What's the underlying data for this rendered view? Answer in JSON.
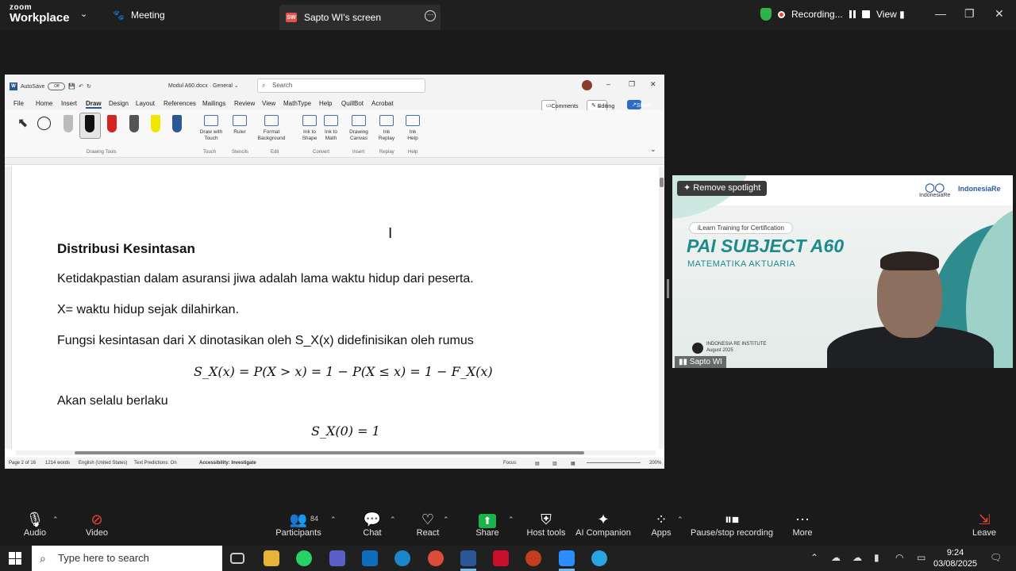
{
  "zoom_top": {
    "logo_line1": "zoom",
    "logo_line2": "Workplace",
    "meeting_label": "Meeting",
    "share_badge": "SW",
    "share_tab_label": "Sapto WI's screen",
    "recording_label": "Recording...",
    "view_label": "View"
  },
  "word": {
    "autosave_label": "AutoSave",
    "autosave_state": "Off",
    "doc_name": "Modul A60.docx",
    "sensitivity": "General",
    "search_placeholder": "Search",
    "menu": [
      "File",
      "Home",
      "Insert",
      "Draw",
      "Design",
      "Layout",
      "References",
      "Mailings",
      "Review",
      "View",
      "MathType",
      "Help",
      "QuillBot",
      "Acrobat"
    ],
    "active_menu": "Draw",
    "comments_label": "Comments",
    "editing_label": "Editing",
    "share_label": "Share",
    "ribbon": {
      "draw_with_touch": "Draw with Touch",
      "ruler": "Ruler",
      "format_background": "Format Background",
      "ink_to_shape": "Ink to Shape",
      "ink_to_math": "Ink to Math",
      "drawing_canvas": "Drawing Canvas",
      "ink_replay": "Ink Replay",
      "ink_help": "Ink Help",
      "groups": [
        "Drawing Tools",
        "Touch",
        "Stencils",
        "Edit",
        "Convert",
        "Insert",
        "Replay",
        "Help"
      ]
    },
    "document": {
      "heading": "Distribusi Kesintasan",
      "p1": "Ketidakpastian dalam asuransi jiwa adalah lama waktu hidup dari peserta.",
      "p2": "X= waktu hidup sejak dilahirkan.",
      "p3": "Fungsi kesintasan dari X dinotasikan oleh S_X(x) didefinisikan oleh rumus",
      "eq1": "S_X(x) = P(X > x) = 1 − P(X ≤ x) = 1 − F_X(x)",
      "p4": "Akan selalu berlaku",
      "eq2": "S_X(0) = 1"
    },
    "status": {
      "page": "Page 2 of 16",
      "words": "1214 words",
      "language": "English (United States)",
      "predictions": "Text Predictions: On",
      "accessibility": "Accessibility: Investigate",
      "focus": "Focus",
      "zoom": "200%"
    }
  },
  "video": {
    "remove_spotlight": "Remove spotlight",
    "pill": "iLearn Training for Certification",
    "title": "PAI SUBJECT A60",
    "subtitle": "MATEMATIKA AKTUARIA",
    "logo1": "IndonesiaRe",
    "logo2": "IndonesiaRe",
    "institute": "INDONESIA RE INSTITUTE",
    "institute_date": "August 2025",
    "name": "Sapto WI"
  },
  "zoom_bottom": {
    "audio": "Audio",
    "video": "Video",
    "participants": "Participants",
    "participants_count": "84",
    "chat": "Chat",
    "react": "React",
    "share": "Share",
    "host_tools": "Host tools",
    "ai_companion": "AI Companion",
    "apps": "Apps",
    "pause_recording": "Pause/stop recording",
    "more": "More",
    "leave": "Leave"
  },
  "taskbar": {
    "search_placeholder": "Type here to search",
    "time": "9:24",
    "date": "03/08/2025"
  },
  "colors": {
    "zoom_bg": "#1a1a1a",
    "share_green": "#19b34a",
    "recording_red": "#e43",
    "word_blue": "#2b5797",
    "teal": "#1d8a8e"
  }
}
